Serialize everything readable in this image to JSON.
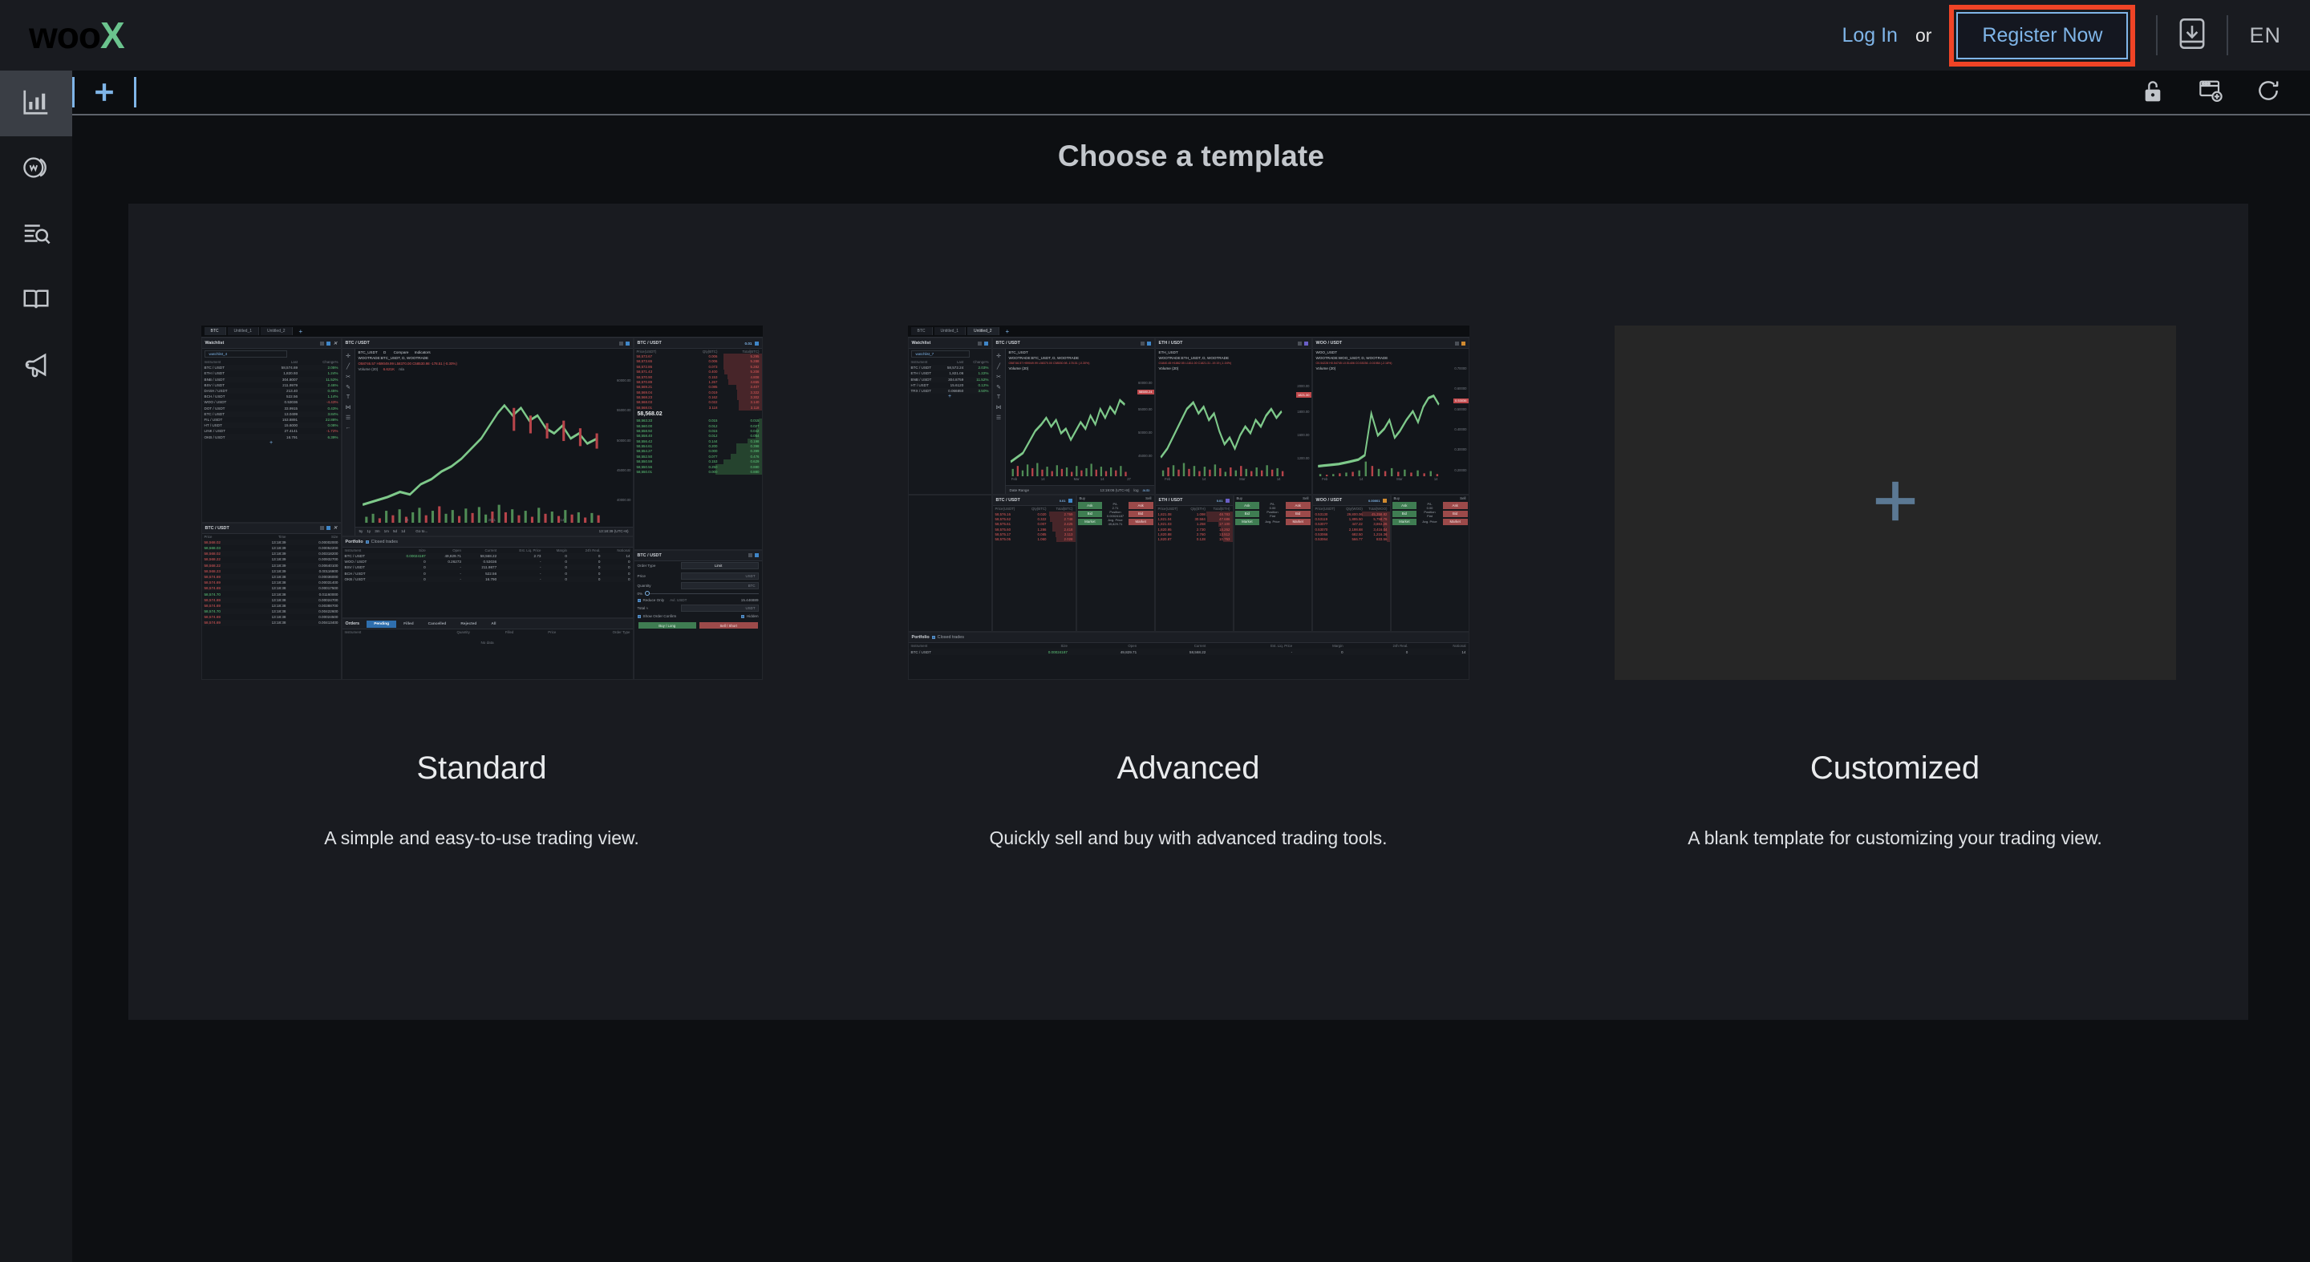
{
  "header": {
    "logo_woo": "woo",
    "logo_x": "X",
    "login_label": "Log In",
    "or_label": "or",
    "register_label": "Register Now",
    "download_icon": "mobile-download-icon",
    "language": "EN",
    "accent_red": "#f04426",
    "accent_blue": "#7fb5e8",
    "accent_green": "#6bc48e"
  },
  "sidebar": {
    "items": [
      {
        "name": "chart-icon",
        "label": "Markets",
        "active": true
      },
      {
        "name": "woo-coin-icon",
        "label": "WOO",
        "active": false
      },
      {
        "name": "search-list-icon",
        "label": "Explore",
        "active": false
      },
      {
        "name": "book-icon",
        "label": "Docs",
        "active": false
      },
      {
        "name": "megaphone-icon",
        "label": "Announcements",
        "active": false
      }
    ]
  },
  "tabbar": {
    "add_tab_label": "+",
    "actions": [
      {
        "name": "unlock-icon",
        "label": "Unlock layout"
      },
      {
        "name": "add-window-icon",
        "label": "Add window"
      },
      {
        "name": "refresh-icon",
        "label": "Reset"
      }
    ]
  },
  "main": {
    "title": "Choose a template",
    "templates": [
      {
        "id": "standard",
        "title": "Standard",
        "description": "A simple and easy-to-use trading view.",
        "preview": "standard-trading-layout"
      },
      {
        "id": "advanced",
        "title": "Advanced",
        "description": "Quickly sell and buy with advanced trading tools.",
        "preview": "advanced-trading-layout"
      },
      {
        "id": "customized",
        "title": "Customized",
        "description": "A blank template for customizing your trading view.",
        "preview": "blank-plus"
      }
    ]
  },
  "preview_standard": {
    "tabs": [
      "BTC",
      "Untitled_1",
      "Untitled_2"
    ],
    "watchlist": {
      "panel_title": "Watchlist",
      "selector": "watchlist_4",
      "columns": [
        "Instrument",
        "Last",
        "Change%"
      ],
      "rows": [
        [
          "BTC / USDT",
          "58,574.69",
          "2.05%",
          "up"
        ],
        [
          "ETH / USDT",
          "1,820.93",
          "1.24%",
          "up"
        ],
        [
          "BNB / USDT",
          "304.8007",
          "11.52%",
          "up"
        ],
        [
          "BSV / USDT",
          "211.9979",
          "2.46%",
          "up"
        ],
        [
          "DASH / USDT",
          "213.40",
          "0.45%",
          "up"
        ],
        [
          "BCH / USDT",
          "522.56",
          "1.14%",
          "up"
        ],
        [
          "WOO / USDT",
          "0.53036",
          "-4.43%",
          "dn"
        ],
        [
          "DOT / USDT",
          "33.9915",
          "0.43%",
          "up"
        ],
        [
          "ETC / USDT",
          "13.0499",
          "3.84%",
          "up"
        ],
        [
          "FIL / USDT",
          "153.8891",
          "22.88%",
          "up"
        ],
        [
          "HT / USDT",
          "15.6000",
          "0.08%",
          "up"
        ],
        [
          "LINK / USDT",
          "27.4141",
          "-1.72%",
          "dn"
        ],
        [
          "OKB / USDT",
          "16.791",
          "6.39%",
          "up"
        ]
      ]
    },
    "trades": {
      "panel_title": "BTC / USDT",
      "columns": [
        "Price",
        "Time",
        "Size"
      ],
      "rows": [
        [
          "58,568.02",
          "13:18:39",
          "0.00002000",
          "dn"
        ],
        [
          "58,568.03",
          "13:18:39",
          "0.00052200",
          "up"
        ],
        [
          "58,568.02",
          "13:18:39",
          "0.00318200",
          "dn"
        ],
        [
          "58,568.22",
          "13:18:39",
          "0.00932700",
          "dn"
        ],
        [
          "58,568.22",
          "13:18:39",
          "0.00640100",
          "dn"
        ],
        [
          "58,568.23",
          "13:18:39",
          "0.00116800",
          "dn"
        ],
        [
          "58,574.69",
          "13:18:38",
          "0.00036000",
          "dn"
        ],
        [
          "58,574.69",
          "13:18:38",
          "0.00031400",
          "dn"
        ],
        [
          "58,574.69",
          "13:18:38",
          "0.00017500",
          "dn"
        ],
        [
          "58,574.70",
          "13:18:38",
          "0.01160000",
          "up"
        ],
        [
          "58,574.69",
          "13:18:38",
          "0.00024700",
          "dn"
        ],
        [
          "58,574.69",
          "13:18:38",
          "0.00388700",
          "dn"
        ],
        [
          "58,574.70",
          "13:18:38",
          "0.00422600",
          "up"
        ],
        [
          "58,574.69",
          "13:18:38",
          "0.00024500",
          "dn"
        ],
        [
          "58,574.69",
          "13:18:38",
          "0.00413400",
          "dn"
        ]
      ]
    },
    "chart": {
      "panel_title": "BTC / USDT",
      "symbol": "BTC_USDT",
      "interval": "D",
      "compare_label": "Compare",
      "indicators_label": "Indicators",
      "series_title": "WOOTRADE:BTC_USDT, D, WOOTRADE",
      "ohlc": "O58746.57  H59049.99  L58370.00  C58530.98  -178.51 (-0.30%)",
      "volume_label": "Volume (20)",
      "volume_value": "6.621K",
      "volume_na": "n/a",
      "timeframes": [
        "5y",
        "1y",
        "3m",
        "1m",
        "5d",
        "1d"
      ],
      "goto_label": "Go to...",
      "timestamp": "13:18:39 (UTC+8)",
      "xticks": [
        "14",
        "2021",
        "14"
      ],
      "yticks": [
        "60000.00",
        "55000.00",
        "50000.00",
        "45000.00",
        "40000.00"
      ]
    },
    "orderbook": {
      "panel_title": "BTC / USDT",
      "tick": "0.01",
      "columns": [
        "Price(USDT)",
        "Qty(BTC)",
        "Total(BTC)"
      ],
      "asks": [
        [
          "58,573.67",
          "0.006",
          "5.295"
        ],
        [
          "58,573.65",
          "0.006",
          "5.288"
        ],
        [
          "58,572.86",
          "0.073",
          "5.282"
        ],
        [
          "58,571.43",
          "0.400",
          "5.208"
        ],
        [
          "58,570.90",
          "0.153",
          "4.808"
        ],
        [
          "58,570.89",
          "1.267",
          "4.655"
        ],
        [
          "58,569.21",
          "0.085",
          "3.407"
        ],
        [
          "58,569.04",
          "0.019",
          "3.322"
        ],
        [
          "58,568.23",
          "0.162",
          "3.302"
        ],
        [
          "58,568.03",
          "0.022",
          "3.140"
        ],
        [
          "58,568.01",
          "3.118",
          "3.118"
        ]
      ],
      "mid_price": "58,568.02",
      "bids": [
        [
          "58,563.33",
          "0.015",
          "0.015"
        ],
        [
          "58,560.00",
          "0.012",
          "0.027"
        ],
        [
          "58,558.92",
          "0.015",
          "0.042"
        ],
        [
          "58,558.40",
          "0.012",
          "0.054"
        ],
        [
          "58,556.42",
          "0.144",
          "0.198"
        ],
        [
          "58,554.61",
          "0.200",
          "0.398"
        ],
        [
          "58,554.27",
          "0.000",
          "0.399"
        ],
        [
          "58,552.50",
          "0.077",
          "0.476"
        ],
        [
          "58,550.59",
          "0.153",
          "0.629"
        ],
        [
          "58,550.56",
          "0.250",
          "0.880"
        ],
        [
          "58,550.01",
          "0.000",
          "0.880"
        ]
      ]
    },
    "order_form": {
      "panel_title": "BTC / USDT",
      "order_type_label": "Order Type",
      "order_type_value": "Limit",
      "price_label": "Price",
      "price_unit": "USDT",
      "quantity_label": "Quantity",
      "quantity_unit": "BTC",
      "slider_value": "0%",
      "reduce_only_label": "Reduce Only",
      "available_label": "Avl. USDT",
      "available_value": "15.446889",
      "total_label": "Total  ≈",
      "total_unit": "USDT",
      "show_confirm_label": "Show Order Confirm",
      "hidden_label": "Hidden",
      "buy_label": "Buy / Long",
      "sell_label": "Sell / Short"
    },
    "portfolio": {
      "panel_title": "Portfolio",
      "closed_trades_label": "Closed trades",
      "columns": [
        "Instrument",
        "Size",
        "Open",
        "Current",
        "Est. Liq. Price",
        "Margin",
        "24h Real.",
        "Notional"
      ],
      "rows": [
        [
          "BTC / USDT",
          "0.00024187",
          "49,829.71",
          "58,568.22",
          "2.73",
          "0",
          "0",
          "14"
        ],
        [
          "WOO / USDT",
          "0",
          "0.26273",
          "0.53036",
          "-",
          "0",
          "0",
          "0"
        ],
        [
          "BSV / USDT",
          "0",
          "-",
          "211.9877",
          "-",
          "0",
          "0",
          "0"
        ],
        [
          "BCH / USDT",
          "0",
          "-",
          "522.56",
          "-",
          "0",
          "0",
          "0"
        ],
        [
          "OKB / USDT",
          "0",
          "-",
          "16.790",
          "-",
          "0",
          "0",
          "0"
        ]
      ]
    },
    "orders": {
      "panel_title": "Orders",
      "tabs": [
        "Pending",
        "Filled",
        "Cancelled",
        "Rejected",
        "All"
      ],
      "active_tab": "Pending",
      "columns": [
        "Instrument",
        "Quantity",
        "Filled",
        "Price",
        "Order Type"
      ],
      "empty_text": "No data"
    }
  },
  "preview_advanced": {
    "tabs": [
      "BTC",
      "Untitled_1",
      "Untitled_2"
    ],
    "watchlist": {
      "panel_title": "Watchlist",
      "selector": "watchlist_7",
      "columns": [
        "Instrument",
        "Last",
        "Change%"
      ],
      "rows": [
        [
          "BTC / USDT",
          "58,572.24",
          "2.03%",
          "up"
        ],
        [
          "ETH / USDT",
          "1,821.06",
          "1.22%",
          "up"
        ],
        [
          "BNB / USDT",
          "304.8759",
          "11.52%",
          "up"
        ],
        [
          "HT / USDT",
          "15.6120",
          "0.12%",
          "up"
        ],
        [
          "TRX / USDT",
          "0.066850",
          "3.50%",
          "up"
        ]
      ]
    },
    "charts": [
      {
        "panel_title": "BTC / USDT",
        "symbol": "BTC_USDT",
        "series_title": "WOOTRADE:BTC_USDT, D, WOOTRADE",
        "ohlc": "O58746.57  H59049.99  L58370.00  C58530.98  -178.51 (-0.30%)",
        "volume_label": "Volume (20)",
        "last_price": "58580.24",
        "yticks": [
          "60000.00",
          "55000.00",
          "50000.00",
          "45000.00",
          "40000.00"
        ],
        "xticks": [
          "Feb",
          "14",
          "Mar",
          "14",
          "27",
          "9"
        ],
        "date_range_label": "Date Range",
        "timestamp": "13:19:06 (UTC+8)",
        "log_label": "log",
        "auto_label": "auto"
      },
      {
        "panel_title": "ETH / USDT",
        "symbol": "ETH_USDT",
        "series_title": "WOOTRADE:ETH_USDT, D, WOOTRADE",
        "ohlc": "O1840.45  H1862.55  L1811.00  C1821.31  -19.19 (-1.04%)",
        "volume_label": "Volume (20)",
        "last_price": "1821.30",
        "yticks": [
          "2000.00",
          "1800.00",
          "1600.00",
          "1200.00",
          "1000.00"
        ],
        "xticks": [
          "Feb",
          "14",
          "Mar",
          "14",
          "27",
          "9"
        ]
      },
      {
        "panel_title": "WOO / USDT",
        "symbol": "WOO_USDT",
        "series_title": "WOOTRADE:WOO_USDT, D, WOOTRADE",
        "ohlc": "O0.54228  H0.54745  L0.51406  C0.53036  -0.01984 (-2.18%)",
        "volume_label": "Volume (20)",
        "last_price": "0.53036",
        "yticks": [
          "0.70000",
          "0.60000",
          "0.50000",
          "0.40000",
          "0.30000",
          "0.20000",
          "0.10000",
          "0.00000"
        ],
        "xticks": [
          "Feb",
          "14",
          "Mar",
          "14",
          "27",
          "9"
        ]
      }
    ],
    "orderbooks": [
      {
        "panel_title": "BTC / USDT",
        "tick": "0.01",
        "columns": [
          "Price(USDT)",
          "Qty(BTC)",
          "Total(BTC)"
        ],
        "rows": [
          [
            "58,576.16",
            "0.020",
            "2.769"
          ],
          [
            "58,575.62",
            "0.322",
            "2.748"
          ],
          [
            "58,575.61",
            "0.007",
            "2.425"
          ],
          [
            "58,575.60",
            "1.286",
            "2.418"
          ],
          [
            "58,575.17",
            "0.085",
            "2.113"
          ],
          [
            "58,575.05",
            "1.060",
            "2.028"
          ]
        ]
      },
      {
        "panel_title": "ETH / USDT",
        "tick": "0.01",
        "columns": [
          "Price(USDT)",
          "Qty(ETH)",
          "Total(ETH)"
        ],
        "rows": [
          [
            "1,821.08",
            "1.098",
            "48.783"
          ],
          [
            "1,821.04",
            "30.584",
            "47.686"
          ],
          [
            "1,821.03",
            "1.258",
            "17.100"
          ],
          [
            "1,820.95",
            "2.730",
            "14.262"
          ],
          [
            "1,820.88",
            "2.760",
            "13.512"
          ],
          [
            "1,820.87",
            "0.128",
            "10.753"
          ]
        ]
      },
      {
        "panel_title": "WOO / USDT",
        "tick": "0.00001",
        "columns": [
          "Price(USDT)",
          "Qty(WOO)",
          "Total(WOO)"
        ],
        "rows": [
          [
            "0.53130",
            "29,800.06",
            "45,358.82"
          ],
          [
            "0.53119",
            "1,895.50",
            "5,758.76"
          ],
          [
            "0.53077",
            "447.22",
            "3,863.26"
          ],
          [
            "0.53070",
            "2,198.88",
            "3,416.04"
          ],
          [
            "0.53066",
            "682.50",
            "1,216.36"
          ],
          [
            "0.53064",
            "566.77",
            "833.56"
          ]
        ]
      }
    ],
    "trade_grid": {
      "buy_label": "Buy",
      "sell_label": "Sell",
      "ask_label": "Ask",
      "bid_label": "Bid",
      "market_label": "Market",
      "pl_label": "P/L",
      "pl_value": "2.71",
      "position_label": "Position",
      "position_value": "0.00024187",
      "avg_price_label": "Avg. Price",
      "avg_price_value": "49,829.71",
      "flat_label": "Flat",
      "zero_value": "0.00"
    },
    "bottom": {
      "panel_title": "Portfolio",
      "closed_trades_label": "Closed trades",
      "columns": [
        "Instrument",
        "Size",
        "Open",
        "Current",
        "Est. Liq. Price",
        "Margin",
        "24h Real.",
        "Notional"
      ],
      "rows": [
        [
          "BTC / USDT",
          "0.00024187",
          "49,829.71",
          "58,568.22",
          "-",
          "0",
          "0",
          "14"
        ]
      ]
    }
  }
}
